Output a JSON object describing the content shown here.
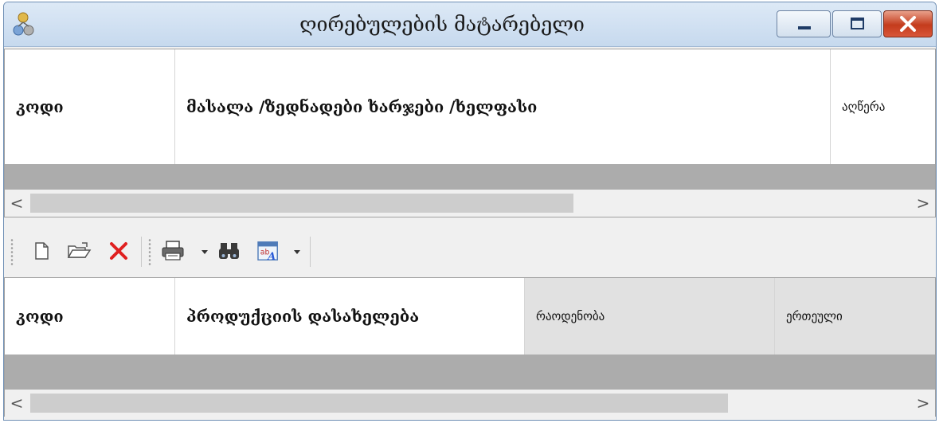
{
  "window": {
    "title": "ღირებულების მატარებელი",
    "accent_color": "#c6d9ee",
    "close_color": "#c43b1c"
  },
  "grid_top": {
    "columns": [
      {
        "label": "კოდი"
      },
      {
        "label": "მასალა /ზედნადები ხარჯები /ხელფასი"
      },
      {
        "label": "აღწერა"
      }
    ]
  },
  "toolbar": {
    "icons": [
      "new-document-icon",
      "open-folder-icon",
      "delete-icon",
      "print-icon",
      "dropdown-arrow-icon",
      "binoculars-find-icon",
      "column-chooser-icon",
      "dropdown-arrow-icon"
    ]
  },
  "grid_bottom": {
    "columns": [
      {
        "label": "კოდი"
      },
      {
        "label": "პროდუქციის დასახელება"
      },
      {
        "label": "რაოდენობა"
      },
      {
        "label": "ერთეული"
      }
    ]
  },
  "scrollbars": {
    "left_arrow": "<",
    "right_arrow": ">"
  }
}
